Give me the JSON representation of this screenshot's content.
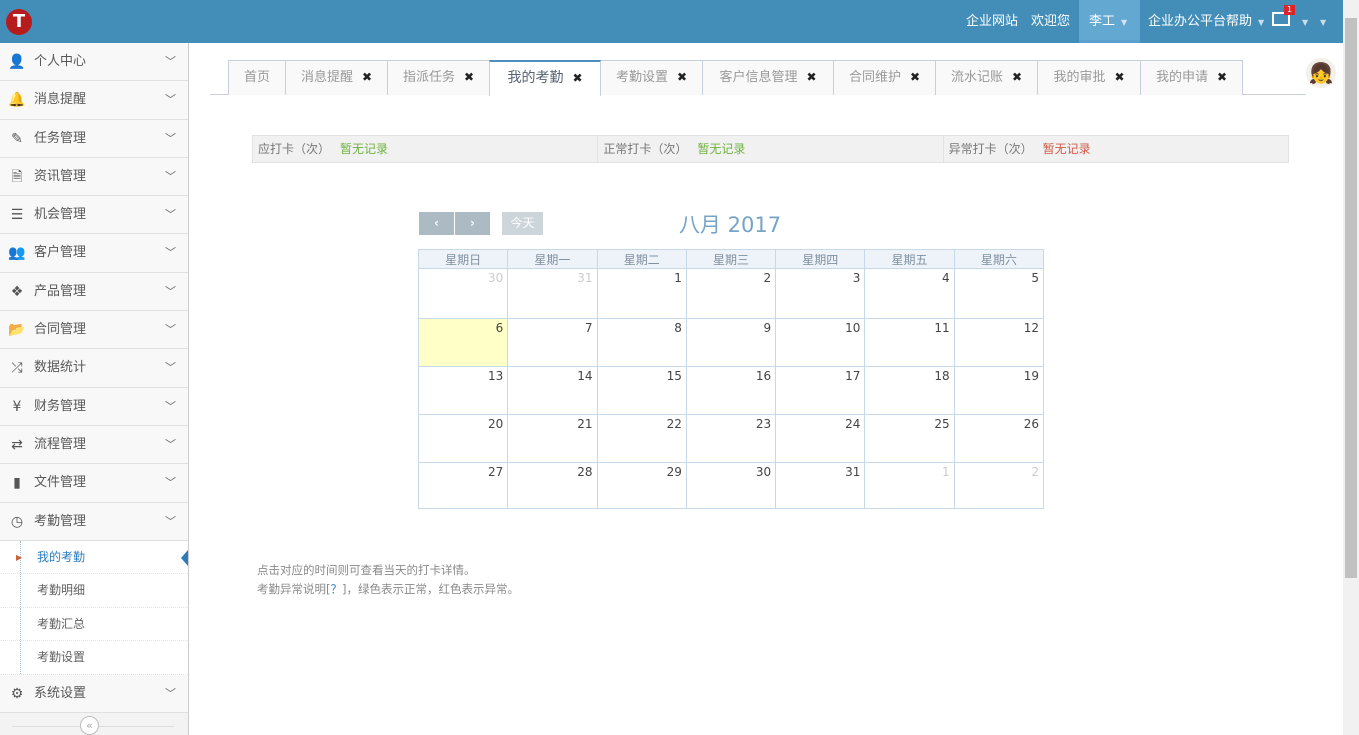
{
  "header": {
    "logo_letter": "T",
    "logo_text": "",
    "links": [
      "企业网站",
      "欢迎您"
    ],
    "user": "李工",
    "help": "企业办公平台帮助",
    "mail_count": "1"
  },
  "sidebar": {
    "items": [
      {
        "label": "个人中心",
        "icon": "user-icon"
      },
      {
        "label": "消息提醒",
        "icon": "bell-icon"
      },
      {
        "label": "任务管理",
        "icon": "edit-icon"
      },
      {
        "label": "资讯管理",
        "icon": "document-icon"
      },
      {
        "label": "机会管理",
        "icon": "list-icon"
      },
      {
        "label": "客户管理",
        "icon": "users-icon"
      },
      {
        "label": "产品管理",
        "icon": "dropbox-icon"
      },
      {
        "label": "合同管理",
        "icon": "folder-open-icon"
      },
      {
        "label": "数据统计",
        "icon": "random-icon"
      },
      {
        "label": "财务管理",
        "icon": "yen-icon"
      },
      {
        "label": "流程管理",
        "icon": "retweet-icon"
      },
      {
        "label": "文件管理",
        "icon": "file-icon"
      },
      {
        "label": "考勤管理",
        "icon": "clock-icon"
      }
    ],
    "sub_items": [
      "我的考勤",
      "考勤明细",
      "考勤汇总",
      "考勤设置"
    ],
    "last_item": {
      "label": "系统设置",
      "icon": "gear-icon"
    },
    "collapse": "«"
  },
  "tabs": [
    {
      "label": "首页",
      "close": false
    },
    {
      "label": "消息提醒",
      "close": true
    },
    {
      "label": "指派任务",
      "close": true
    },
    {
      "label": "我的考勤",
      "close": true,
      "active": true
    },
    {
      "label": "考勤设置",
      "close": true
    },
    {
      "label": "客户信息管理",
      "close": true
    },
    {
      "label": "合同维护",
      "close": true
    },
    {
      "label": "流水记账",
      "close": true
    },
    {
      "label": "我的审批",
      "close": true
    },
    {
      "label": "我的申请",
      "close": true
    }
  ],
  "stats": [
    {
      "label": "应打卡（次）",
      "value": "暂无记录",
      "color": "#6fb33f"
    },
    {
      "label": "正常打卡（次）",
      "value": "暂无记录",
      "color": "#6fb33f"
    },
    {
      "label": "异常打卡（次）",
      "value": "暂无记录",
      "color": "#d15b47"
    }
  ],
  "calendar": {
    "title": "八月 2017",
    "prev": "‹",
    "next": "›",
    "today": "今天",
    "weekdays": [
      "星期日",
      "星期一",
      "星期二",
      "星期三",
      "星期四",
      "星期五",
      "星期六"
    ],
    "weeks": [
      [
        "30",
        "31",
        "1",
        "2",
        "3",
        "4",
        "5"
      ],
      [
        "6",
        "7",
        "8",
        "9",
        "10",
        "11",
        "12"
      ],
      [
        "13",
        "14",
        "15",
        "16",
        "17",
        "18",
        "19"
      ],
      [
        "20",
        "21",
        "22",
        "23",
        "24",
        "25",
        "26"
      ],
      [
        "27",
        "28",
        "29",
        "30",
        "31",
        "1",
        "2"
      ]
    ],
    "today_date": "6"
  },
  "notes": {
    "line1": "点击对应的时间则可查看当天的打卡详情。",
    "line2_pre": "考勤异常说明[",
    "line2_q": "？",
    "line2_post": "]，绿色表示正常，红色表示异常。"
  }
}
